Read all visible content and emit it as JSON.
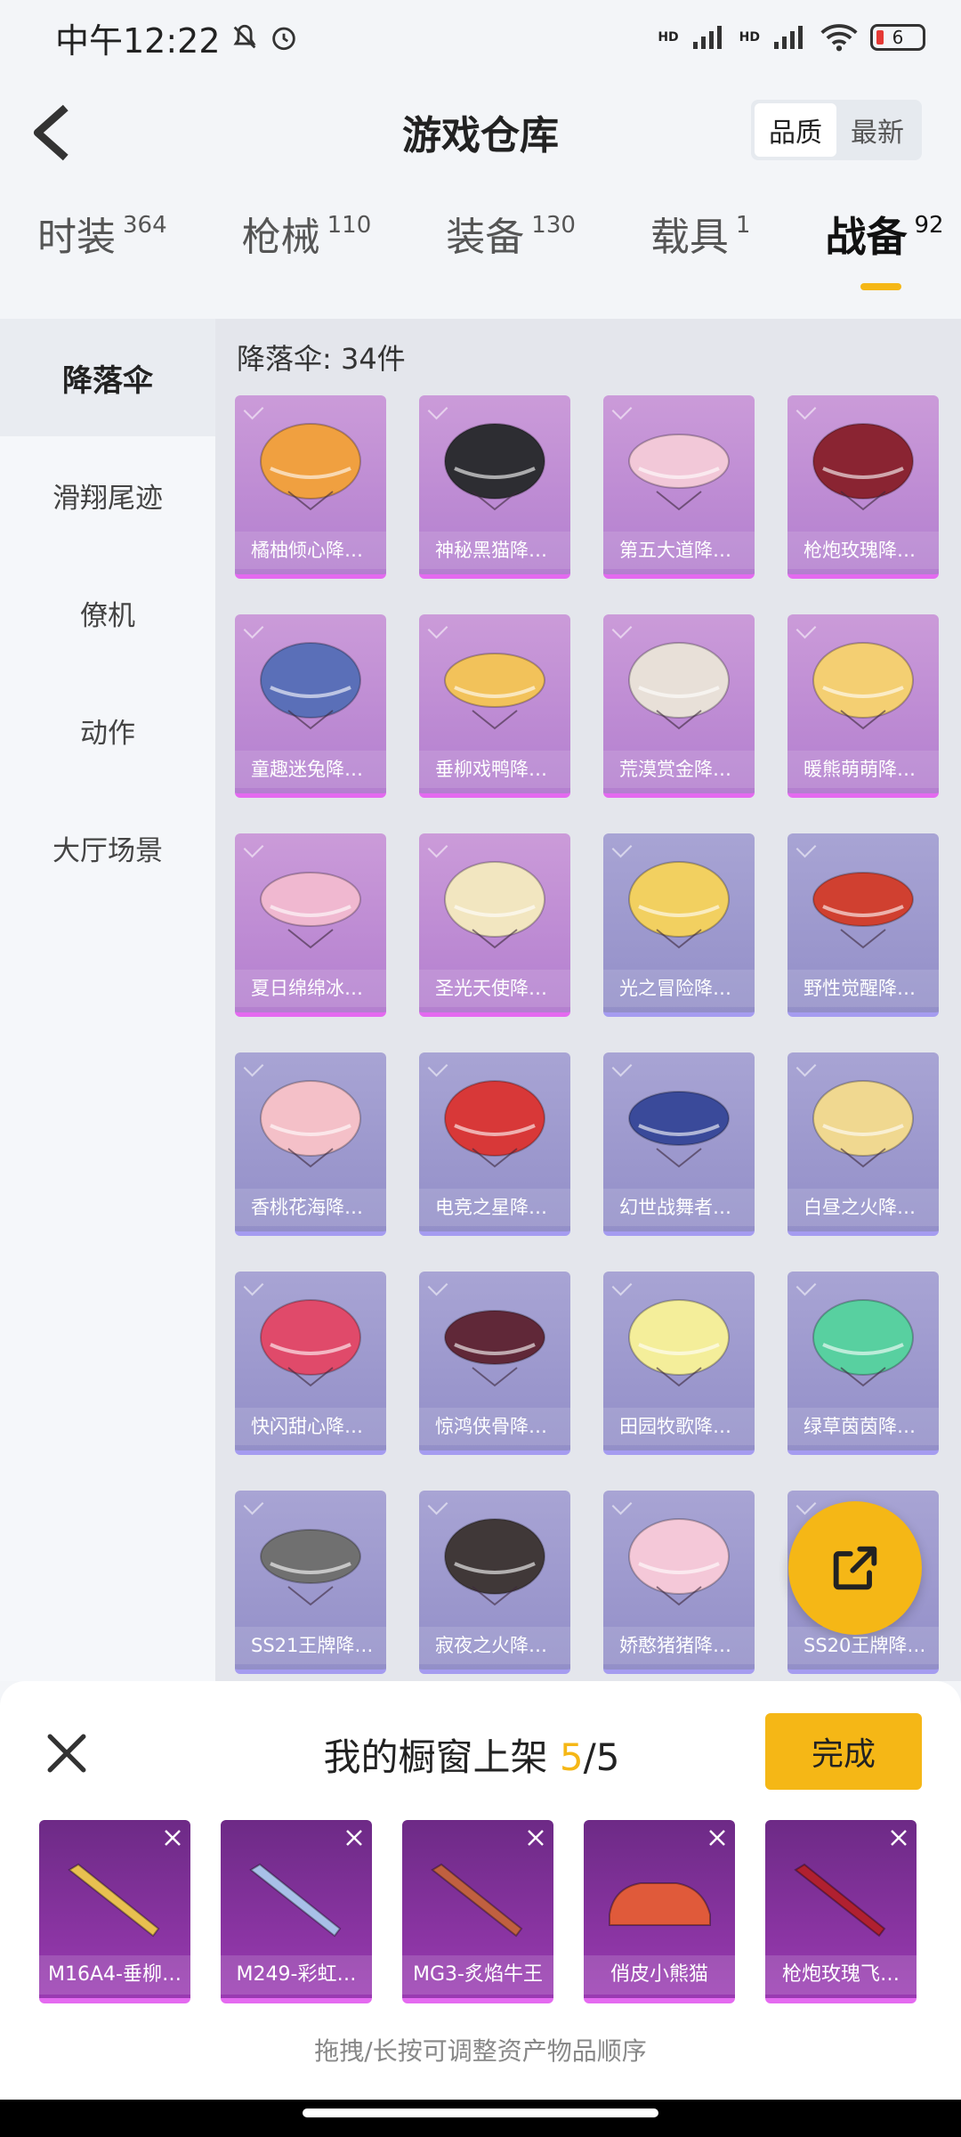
{
  "status_bar": {
    "time": "中午12:22",
    "signal_1": "HD",
    "signal_2": "HD",
    "battery": "6"
  },
  "header": {
    "title": "游戏仓库",
    "sort_options": [
      "品质",
      "最新"
    ],
    "sort_selected": "品质"
  },
  "tabs": [
    {
      "label": "时装",
      "count": "364"
    },
    {
      "label": "枪械",
      "count": "110"
    },
    {
      "label": "装备",
      "count": "130"
    },
    {
      "label": "载具",
      "count": "1"
    },
    {
      "label": "战备",
      "count": "92"
    }
  ],
  "active_tab": "战备",
  "sidebar": {
    "items": [
      "降落伞",
      "滑翔尾迹",
      "僚机",
      "动作",
      "大厅场景"
    ],
    "active": "降落伞"
  },
  "content": {
    "heading": "降落伞: 34件",
    "items": [
      {
        "name": "橘柚倾心降…",
        "tier": "purple",
        "color": "#f0a040"
      },
      {
        "name": "神秘黑猫降…",
        "tier": "purple",
        "color": "#2d2d32"
      },
      {
        "name": "第五大道降…",
        "tier": "purple",
        "color": "#f2c8d8"
      },
      {
        "name": "枪炮玫瑰降…",
        "tier": "purple",
        "color": "#8a2432"
      },
      {
        "name": "童趣迷兔降…",
        "tier": "purple",
        "color": "#5a6fb8"
      },
      {
        "name": "垂柳戏鸭降…",
        "tier": "purple",
        "color": "#f2c25a"
      },
      {
        "name": "荒漠赏金降…",
        "tier": "purple",
        "color": "#e8e0d8"
      },
      {
        "name": "暖熊萌萌降…",
        "tier": "purple",
        "color": "#f4cf72"
      },
      {
        "name": "夏日绵绵冰…",
        "tier": "purple",
        "color": "#f0b8d0"
      },
      {
        "name": "圣光天使降…",
        "tier": "purple",
        "color": "#f2e6c0"
      },
      {
        "name": "光之冒险降…",
        "tier": "blue",
        "color": "#f2d060"
      },
      {
        "name": "野性觉醒降…",
        "tier": "blue",
        "color": "#d04030"
      },
      {
        "name": "香桃花海降…",
        "tier": "blue",
        "color": "#f4c0c8"
      },
      {
        "name": "电竞之星降…",
        "tier": "blue",
        "color": "#d83838"
      },
      {
        "name": "幻世战舞者…",
        "tier": "blue",
        "color": "#3a4a9a"
      },
      {
        "name": "白昼之火降…",
        "tier": "blue",
        "color": "#f0d890"
      },
      {
        "name": "快闪甜心降…",
        "tier": "blue",
        "color": "#e04a6a"
      },
      {
        "name": "惊鸿侠骨降…",
        "tier": "blue",
        "color": "#602838"
      },
      {
        "name": "田园牧歌降…",
        "tier": "blue",
        "color": "#f4ee9a"
      },
      {
        "name": "绿草茵茵降…",
        "tier": "blue",
        "color": "#58d0a0"
      },
      {
        "name": "SS21王牌降…",
        "tier": "blue",
        "color": "#707070"
      },
      {
        "name": "寂夜之火降…",
        "tier": "blue",
        "color": "#403838"
      },
      {
        "name": "娇憨猪猪降…",
        "tier": "blue",
        "color": "#f4c8d8"
      },
      {
        "name": "SS20王牌降…",
        "tier": "blue",
        "color": "#c0b0d8"
      }
    ]
  },
  "showcase": {
    "title": "我的橱窗上架",
    "filled": "5",
    "total": "/5",
    "done_label": "完成",
    "hint": "拖拽/长按可调整资产物品顺序",
    "items": [
      {
        "name": "M16A4-垂柳…",
        "color": "#e8c050"
      },
      {
        "name": "M249-彩虹…",
        "color": "#a8c0e8"
      },
      {
        "name": "MG3-炙焰牛王",
        "color": "#c06040"
      },
      {
        "name": "俏皮小熊猫",
        "color": "#e05a3a"
      },
      {
        "name": "枪炮玫瑰飞…",
        "color": "#b02030"
      }
    ]
  },
  "colors": {
    "accent": "#f5b716",
    "purple_tier": "#e46af0",
    "blue_tier": "#a59cf0"
  }
}
